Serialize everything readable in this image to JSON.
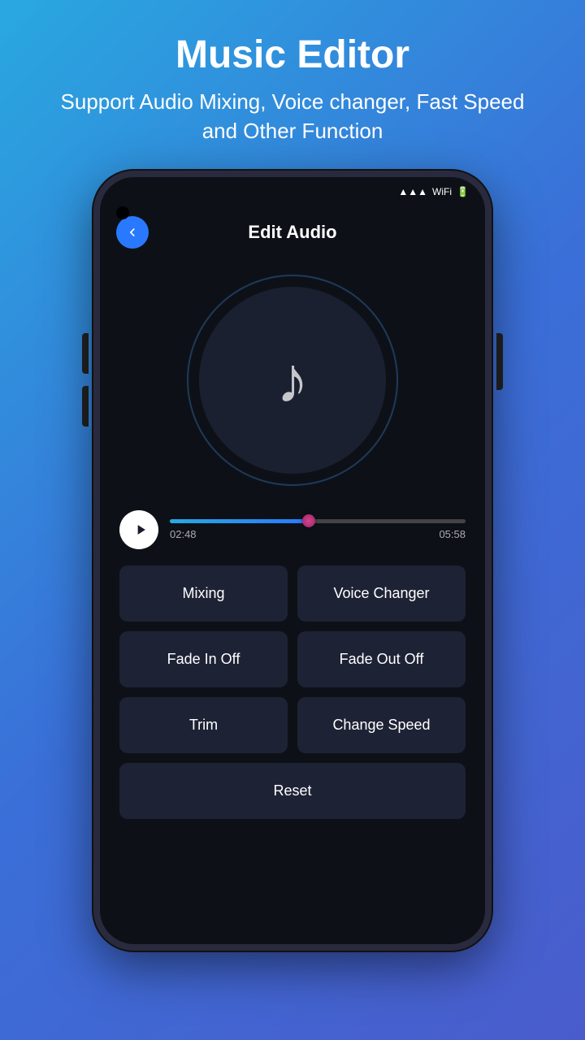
{
  "header": {
    "title": "Music Editor",
    "subtitle": "Support Audio Mixing, Voice changer, Fast Speed and Other Function"
  },
  "appbar": {
    "title": "Edit Audio",
    "back_icon": "chevron-left-icon"
  },
  "player": {
    "current_time": "02:48",
    "total_time": "05:58",
    "progress_percent": 47
  },
  "buttons": {
    "mixing": "Mixing",
    "voice_changer": "Voice Changer",
    "fade_in_off": "Fade In Off",
    "fade_out_off": "Fade Out Off",
    "trim": "Trim",
    "change_speed": "Change Speed",
    "reset": "Reset"
  },
  "status_bar": {
    "icons": [
      "signal",
      "wifi",
      "battery"
    ]
  }
}
